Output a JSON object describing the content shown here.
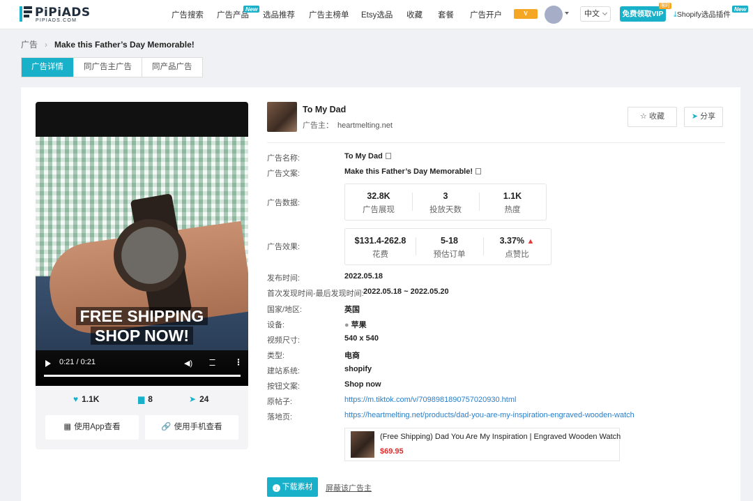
{
  "header": {
    "logo_text": "PiPiADS",
    "logo_sub": "PIPIADS.COM",
    "nav": [
      {
        "label": "广告搜索",
        "badge": ""
      },
      {
        "label": "广告产品",
        "badge": "New"
      },
      {
        "label": "选品推荐",
        "badge": ""
      },
      {
        "label": "广告主榜单",
        "badge": ""
      },
      {
        "label": "Etsy选品",
        "badge": ""
      },
      {
        "label": "收藏",
        "badge": ""
      },
      {
        "label": "套餐",
        "badge": ""
      },
      {
        "label": "广告开户",
        "badge": ""
      }
    ],
    "vip_badge": "V",
    "language": "中文",
    "vip_button": "免费领取VIP",
    "limit_badge": "限时",
    "plugin_link": "Shopify选品插件",
    "plugin_badge": "New"
  },
  "breadcrumb": {
    "root": "广告",
    "current": "Make this Father’s Day Memorable!"
  },
  "tabs": [
    "广告详情",
    "同广告主广告",
    "同产品广告"
  ],
  "video": {
    "overlay_line1": "FREE SHIPPING",
    "overlay_line2": "SHOP NOW!",
    "time": "0:21 / 0:21",
    "stats": {
      "likes": "1.1K",
      "comments": "8",
      "shares": "24"
    },
    "btn_app": "使用App查看",
    "btn_phone": "使用手机查看"
  },
  "ad": {
    "title": "To My Dad",
    "advertiser_label": "广告主：",
    "advertiser": "heartmelting.net",
    "fav_label": "收藏",
    "share_label": "分享"
  },
  "details": {
    "name_label": "广告名称:",
    "name": "To My Dad",
    "copy_label": "广告文案:",
    "copy": "Make this Father’s Day Memorable!",
    "data_label": "广告数据:",
    "data": [
      {
        "value": "32.8K",
        "caption": "广告展现"
      },
      {
        "value": "3",
        "caption": "投放天数"
      },
      {
        "value": "1.1K",
        "caption": "热度"
      }
    ],
    "effect_label": "广告效果:",
    "effect": [
      {
        "value": "$131.4-262.8",
        "caption": "花费"
      },
      {
        "value": "5-18",
        "caption": "预估订单"
      },
      {
        "value": "3.37%",
        "caption": "点赞比"
      }
    ],
    "publish_label": "发布时间:",
    "publish": "2022.05.18",
    "seen_label": "首次发现时间-最后发现时间:",
    "seen": "2022.05.18 ~ 2022.05.20",
    "country_label": "国家/地区:",
    "country": "英国",
    "device_label": "设备:",
    "device": "苹果",
    "size_label": "视频尺寸:",
    "size": "540 x 540",
    "type_label": "类型:",
    "type": "电商",
    "platform_label": "建站系统:",
    "platform": "shopify",
    "cta_label": "按钮文案:",
    "cta": "Shop now",
    "post_label": "原帖子:",
    "post_url": "https://m.tiktok.com/v/7098981890757020930.html",
    "landing_label": "落地页:",
    "landing_url": "https://heartmelting.net/products/dad-you-are-my-inspiration-engraved-wooden-watch"
  },
  "product": {
    "name": "(Free Shipping) Dad You Are My Inspiration | Engraved Wooden Watch",
    "price": "$69.95"
  },
  "actions": {
    "download": "下载素材",
    "block": "屏蔽该广告主"
  },
  "colors": {
    "accent": "#19b1c9",
    "price": "#e02b2b",
    "link": "#2a7ec8",
    "badge": "#f5a623"
  }
}
